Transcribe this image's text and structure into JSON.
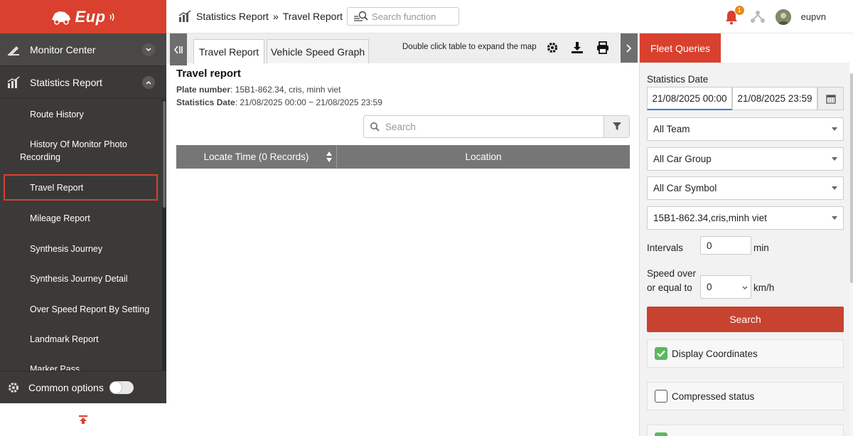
{
  "brand": {
    "logo_text": "Eup"
  },
  "sidebar": {
    "groups": [
      {
        "label": "Monitor Center",
        "icon": "ruler-pen-icon",
        "expanded": false
      },
      {
        "label": "Statistics Report",
        "icon": "bar-chart-icon",
        "expanded": true
      }
    ],
    "items": [
      {
        "label": "Route History"
      },
      {
        "label": "History Of Monitor Photo Recording"
      },
      {
        "label": "Travel Report",
        "active": true
      },
      {
        "label": "Mileage Report"
      },
      {
        "label": "Synthesis Journey"
      },
      {
        "label": "Synthesis Journey Detail"
      },
      {
        "label": "Over Speed Report By Setting"
      },
      {
        "label": "Landmark Report"
      },
      {
        "label": "Marker Pass"
      }
    ],
    "common_options": {
      "label": "Common options",
      "enabled": false
    }
  },
  "topbar": {
    "breadcrumb": [
      "Statistics Report",
      "Travel Report"
    ],
    "breadcrumb_separator": "»",
    "search_placeholder": "Search function",
    "notification_count": "1",
    "username": "eupvn"
  },
  "main": {
    "tabs": [
      {
        "label": "Travel Report",
        "active": true
      },
      {
        "label": "Vehicle Speed Graph",
        "active": false
      }
    ],
    "hint": "Double click table to expand the map",
    "report": {
      "title": "Travel report",
      "plate_label": "Plate number",
      "plate_value": ": 15B1-862.34, cris, minh viet",
      "date_label": "Statistics Date",
      "date_value": ": 21/08/2025 00:00 ~ 21/08/2025 23:59"
    },
    "table_search_placeholder": "Search",
    "columns": [
      "Locate Time (0 Records)",
      "Location"
    ]
  },
  "fleet_queries": {
    "tab_label": "Fleet Queries",
    "statistics_date_label": "Statistics Date",
    "date_from": "21/08/2025 00:00",
    "date_to": "21/08/2025 23:59",
    "team": "All Team",
    "car_group": "All Car Group",
    "car_symbol": "All Car Symbol",
    "vehicle": "15B1-862.34,cris,minh viet",
    "intervals_label": "Intervals",
    "intervals_value": "0",
    "intervals_unit": "min",
    "speed_label_line1": "Speed over",
    "speed_label_line2": "or equal to",
    "speed_value": "0",
    "speed_unit": "km/h",
    "search_button": "Search",
    "display_coordinates": {
      "label": "Display Coordinates",
      "checked": true
    },
    "compressed_status": {
      "label": "Compressed status",
      "checked": false
    }
  },
  "colors": {
    "brand_red": "#d9402e",
    "sidebar_bg": "#3c3a39",
    "search_button": "#c7432f",
    "check_green": "#5cb85c"
  }
}
